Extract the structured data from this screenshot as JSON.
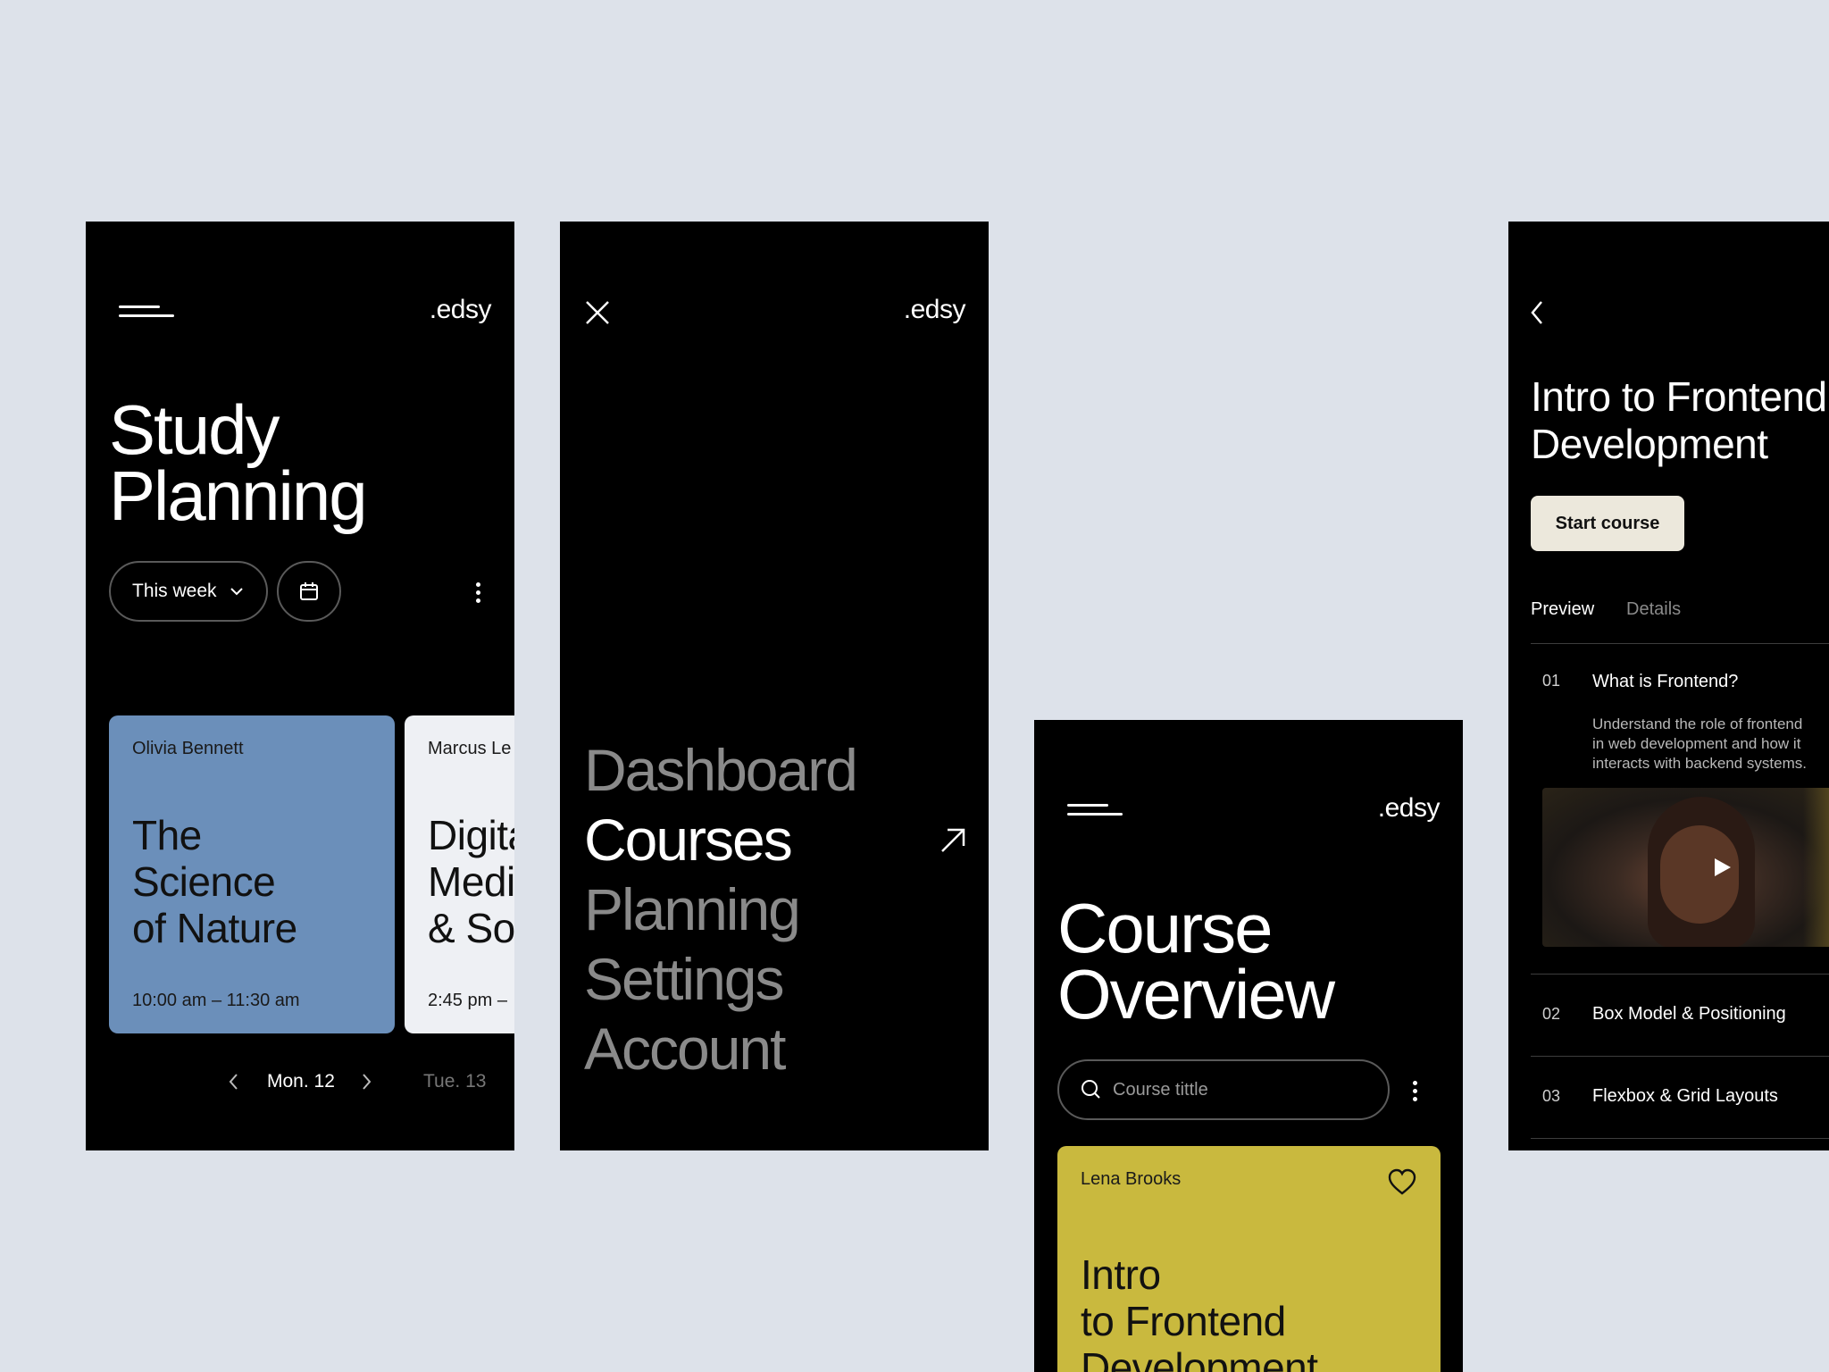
{
  "brand": ".edsy",
  "study_planning": {
    "title_line1": "Study",
    "title_line2": "Planning",
    "filter_label": "This week",
    "cards": [
      {
        "author": "Olivia Bennett",
        "title_lines": [
          "The",
          "Science",
          "of Nature"
        ],
        "time": "10:00 am – 11:30 am",
        "color": "#6b8fba"
      },
      {
        "author": "Marcus Le",
        "title_lines": [
          "Digita",
          "Medi",
          "& Soc"
        ],
        "time": "2:45 pm –",
        "color": "#eef0f4"
      }
    ],
    "day_nav": {
      "current": "Mon. 12",
      "next": "Tue. 13"
    }
  },
  "menu": {
    "items": [
      "Dashboard",
      "Courses",
      "Planning",
      "Settings",
      "Account"
    ],
    "active": "Courses"
  },
  "course_overview": {
    "title_line1": "Course",
    "title_line2": "Overview",
    "search_placeholder": "Course tittle",
    "card": {
      "author": "Lena Brooks",
      "title_lines": [
        "Intro",
        "to Frontend",
        "Development"
      ],
      "color": "#c9b93e"
    }
  },
  "course_detail": {
    "title_line1": "Intro to Frontend",
    "title_line2": "Development",
    "start_button": "Start course",
    "tabs": [
      "Preview",
      "Details"
    ],
    "lessons": [
      {
        "num": "01",
        "title": "What is Frontend?",
        "desc_lines": [
          "Understand the role of frontend",
          "in web development and how it",
          "interacts with backend systems."
        ]
      },
      {
        "num": "02",
        "title": "Box Model & Positioning"
      },
      {
        "num": "03",
        "title": "Flexbox & Grid Layouts"
      }
    ]
  }
}
